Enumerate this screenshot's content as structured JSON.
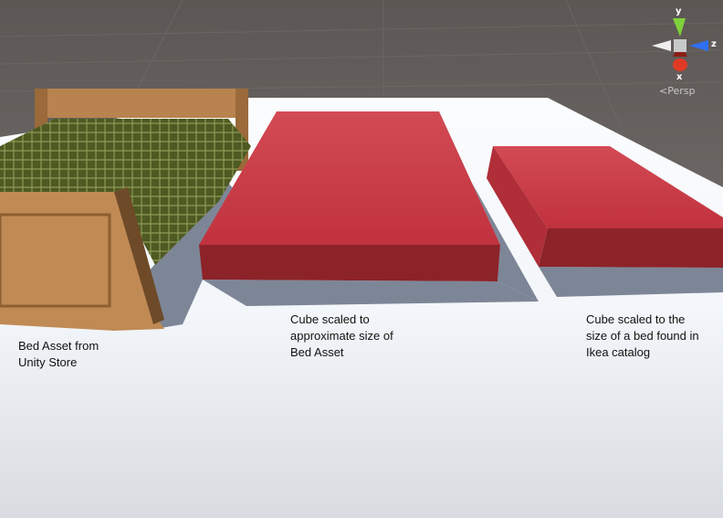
{
  "scene_view": {
    "gizmo": {
      "axes": [
        "y",
        "z",
        "x"
      ],
      "projection_label": "Persp",
      "colors": {
        "y": "#7fd13b",
        "z": "#2f6ff0",
        "x": "#e03a25"
      }
    },
    "objects": [
      {
        "name": "bed-asset"
      },
      {
        "name": "cube-approx",
        "color": "#c8404a"
      },
      {
        "name": "cube-ikea",
        "color": "#c8404a"
      }
    ]
  },
  "annotations": {
    "bed": "Bed Asset from\nUnity Store",
    "cube_approx": "Cube scaled to\napproximate size of\nBed Asset",
    "cube_ikea": "Cube scaled to the\nsize of a bed found in\nIkea catalog"
  }
}
